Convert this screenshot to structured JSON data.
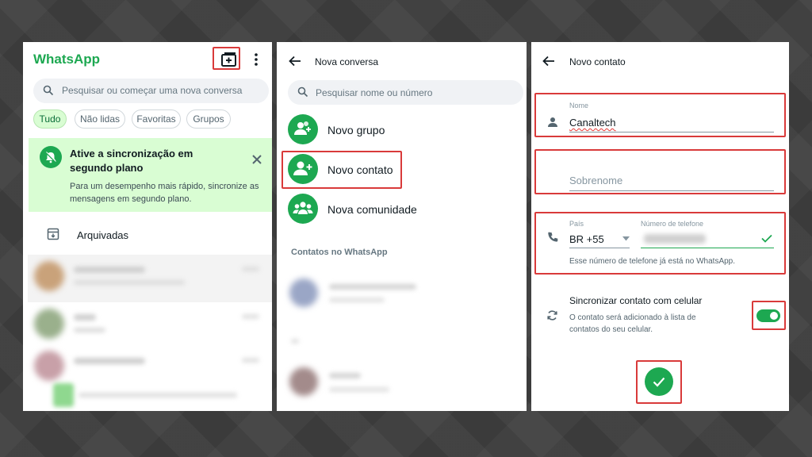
{
  "colors": {
    "brand_green": "#1da851",
    "highlight": "#d93a3a",
    "banner_bg": "#d9fdd3"
  },
  "chats_screen": {
    "app_title": "WhatsApp",
    "search_placeholder": "Pesquisar ou começar uma nova conversa",
    "filters": [
      {
        "label": "Tudo",
        "active": true
      },
      {
        "label": "Não lidas",
        "active": false
      },
      {
        "label": "Favoritas",
        "active": false
      },
      {
        "label": "Grupos",
        "active": false
      }
    ],
    "sync_banner": {
      "title": "Ative a sincronização em segundo plano",
      "body": "Para um desempenho mais rápido, sincronize as mensagens em segundo plano."
    },
    "archived_label": "Arquivadas",
    "icons": [
      "new-chat-icon",
      "more-menu-icon",
      "search-icon",
      "bell-off-icon",
      "close-icon",
      "archive-icon"
    ]
  },
  "new_chat_screen": {
    "title": "Nova conversa",
    "search_placeholder": "Pesquisar nome ou número",
    "options": [
      {
        "label": "Novo grupo",
        "icon": "add-group-icon"
      },
      {
        "label": "Novo contato",
        "icon": "add-contact-icon"
      },
      {
        "label": "Nova comunidade",
        "icon": "community-icon"
      }
    ],
    "section_label": "Contatos no WhatsApp"
  },
  "new_contact_screen": {
    "title": "Novo contato",
    "name_label": "Nome",
    "name_value": "Canaltech",
    "surname_placeholder": "Sobrenome",
    "country_label": "País",
    "country_value": "BR +55",
    "phone_label": "Número de telefone",
    "phone_hint": "Esse número de telefone já está no WhatsApp.",
    "sync_title": "Sincronizar contato com celular",
    "sync_body": "O contato será adicionado à lista de contatos do seu celular.",
    "sync_enabled": true
  }
}
